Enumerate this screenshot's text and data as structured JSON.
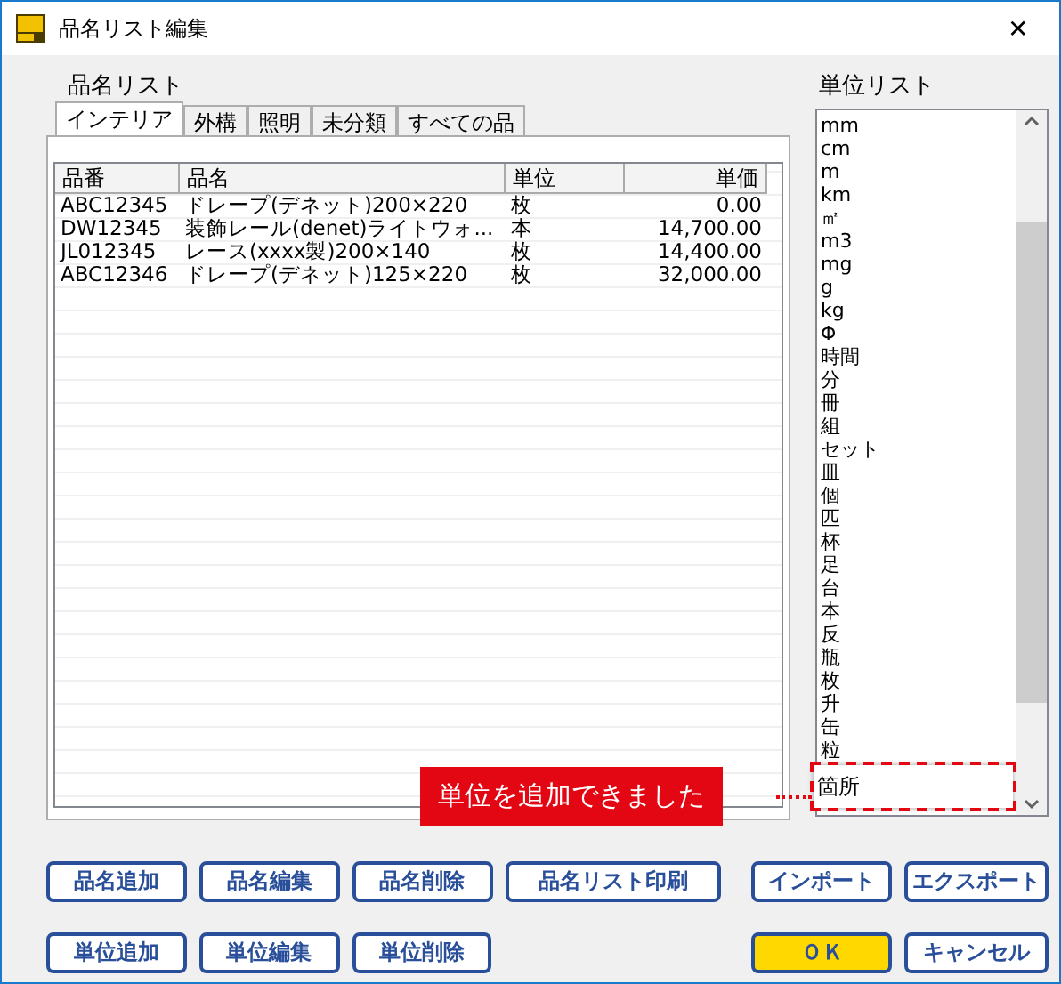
{
  "window": {
    "title": "品名リスト編集",
    "close": "✕"
  },
  "item_list": {
    "label": "品名リスト",
    "tabs": [
      {
        "label": "インテリア",
        "selected": true
      },
      {
        "label": "外構",
        "selected": false
      },
      {
        "label": "照明",
        "selected": false
      },
      {
        "label": "未分類",
        "selected": false
      },
      {
        "label": "すべての品",
        "selected": false
      }
    ],
    "columns": [
      "品番",
      "品名",
      "単位",
      "単価"
    ],
    "rows": [
      [
        "ABC12345",
        "ドレープ(デネット)200×220",
        "枚",
        "0.00"
      ],
      [
        "DW12345",
        "装飾レール(denet)ライトウォ...",
        "本",
        "14,700.00"
      ],
      [
        "JL012345",
        "レース(xxxx製)200×140",
        "枚",
        "14,400.00"
      ],
      [
        "ABC12346",
        "ドレープ(デネット)125×220",
        "枚",
        "32,000.00"
      ]
    ]
  },
  "unit_list": {
    "label": "単位リスト",
    "items": [
      {
        "label": "mm",
        "highlighted": false
      },
      {
        "label": "cm",
        "highlighted": false
      },
      {
        "label": "m",
        "highlighted": false
      },
      {
        "label": "km",
        "highlighted": false
      },
      {
        "label": "㎡",
        "highlighted": false
      },
      {
        "label": "m3",
        "highlighted": false
      },
      {
        "label": "mg",
        "highlighted": false
      },
      {
        "label": "g",
        "highlighted": false
      },
      {
        "label": "kg",
        "highlighted": false
      },
      {
        "label": "Φ",
        "highlighted": false
      },
      {
        "label": "時間",
        "highlighted": false
      },
      {
        "label": "分",
        "highlighted": false
      },
      {
        "label": "冊",
        "highlighted": false
      },
      {
        "label": "組",
        "highlighted": false
      },
      {
        "label": "セット",
        "highlighted": false
      },
      {
        "label": "皿",
        "highlighted": false
      },
      {
        "label": "個",
        "highlighted": false
      },
      {
        "label": "匹",
        "highlighted": false
      },
      {
        "label": "杯",
        "highlighted": false
      },
      {
        "label": "足",
        "highlighted": false
      },
      {
        "label": "台",
        "highlighted": false
      },
      {
        "label": "本",
        "highlighted": false
      },
      {
        "label": "反",
        "highlighted": false
      },
      {
        "label": "瓶",
        "highlighted": false
      },
      {
        "label": "枚",
        "highlighted": false
      },
      {
        "label": "升",
        "highlighted": false
      },
      {
        "label": "缶",
        "highlighted": false
      },
      {
        "label": "粒",
        "highlighted": false
      },
      {
        "label": "箇所",
        "highlighted": true
      }
    ]
  },
  "notice": {
    "text": "単位を追加できました"
  },
  "buttons_row_1": [
    {
      "label": "品名追加"
    },
    {
      "label": "品名編集"
    },
    {
      "label": "品名削除"
    },
    {
      "label": "品名リスト印刷"
    },
    {
      "label": "インポート"
    },
    {
      "label": "エクスポート"
    }
  ],
  "buttons_row_2": [
    {
      "label": "単位追加",
      "kind": "normal"
    },
    {
      "label": "単位編集",
      "kind": "normal"
    },
    {
      "label": "単位削除",
      "kind": "normal"
    },
    {
      "label": "ＯＫ",
      "kind": "primary"
    },
    {
      "label": "キャンセル",
      "kind": "normal"
    }
  ]
}
